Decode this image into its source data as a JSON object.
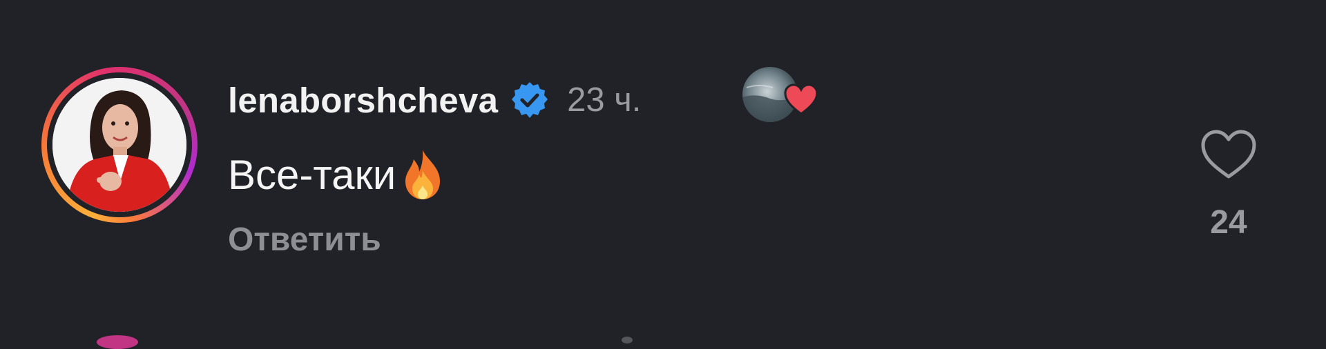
{
  "comment": {
    "username": "lenaborshcheva",
    "verified_icon": "verified-badge-icon",
    "timestamp": "23 ч.",
    "liked_by_author_icon": "author-liked-avatar-heart-icon",
    "text": "Все-таки",
    "emoji_icon": "fire-icon",
    "reply_label": "Ответить",
    "like_icon": "heart-outline-icon",
    "like_count": "24"
  },
  "colors": {
    "background": "#212227",
    "text_primary": "#f5f5f5",
    "text_secondary": "#9a9ba0",
    "verified_blue": "#3897f0",
    "heart_red": "#ed4956"
  }
}
